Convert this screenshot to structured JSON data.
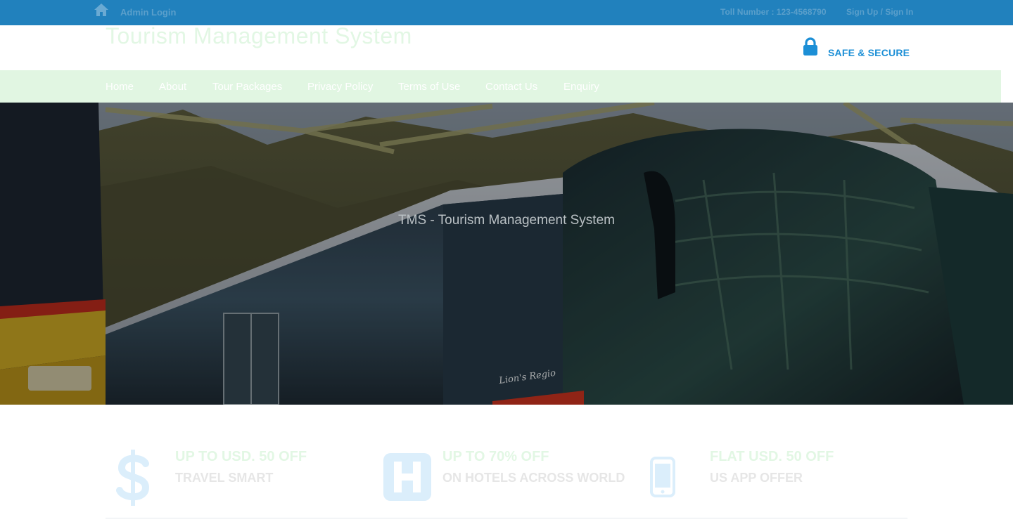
{
  "topbar": {
    "admin_login": "Admin Login",
    "toll_number": "Toll Number : 123-4568790",
    "signup_signin": "Sign Up / Sign In"
  },
  "header": {
    "site_title": "Tourism Management System",
    "secure_label": "SAFE & SECURE"
  },
  "nav": {
    "items": [
      {
        "label": "Home"
      },
      {
        "label": "About"
      },
      {
        "label": "Tour Packages"
      },
      {
        "label": "Privacy Policy"
      },
      {
        "label": "Terms of Use"
      },
      {
        "label": "Contact Us"
      },
      {
        "label": "Enquiry"
      }
    ]
  },
  "hero": {
    "caption": "TMS - Tourism Management System",
    "bus_lettering": "Lion's Regio"
  },
  "offers": [
    {
      "icon": "dollar-icon",
      "title": "UP TO USD. 50 OFF",
      "subtitle": "TRAVEL SMART"
    },
    {
      "icon": "hotel-icon",
      "title": "UP TO 70% OFF",
      "subtitle": "ON HOTELS ACROSS WORLD"
    },
    {
      "icon": "mobile-icon",
      "title": "FLAT USD. 50 OFF",
      "subtitle": "US APP OFFER"
    }
  ],
  "colors": {
    "topbar": "#2181bd",
    "nav_bg": "#e1f6e2",
    "accent_blue": "#1c8fd6",
    "title_green": "#e2f7e4"
  }
}
